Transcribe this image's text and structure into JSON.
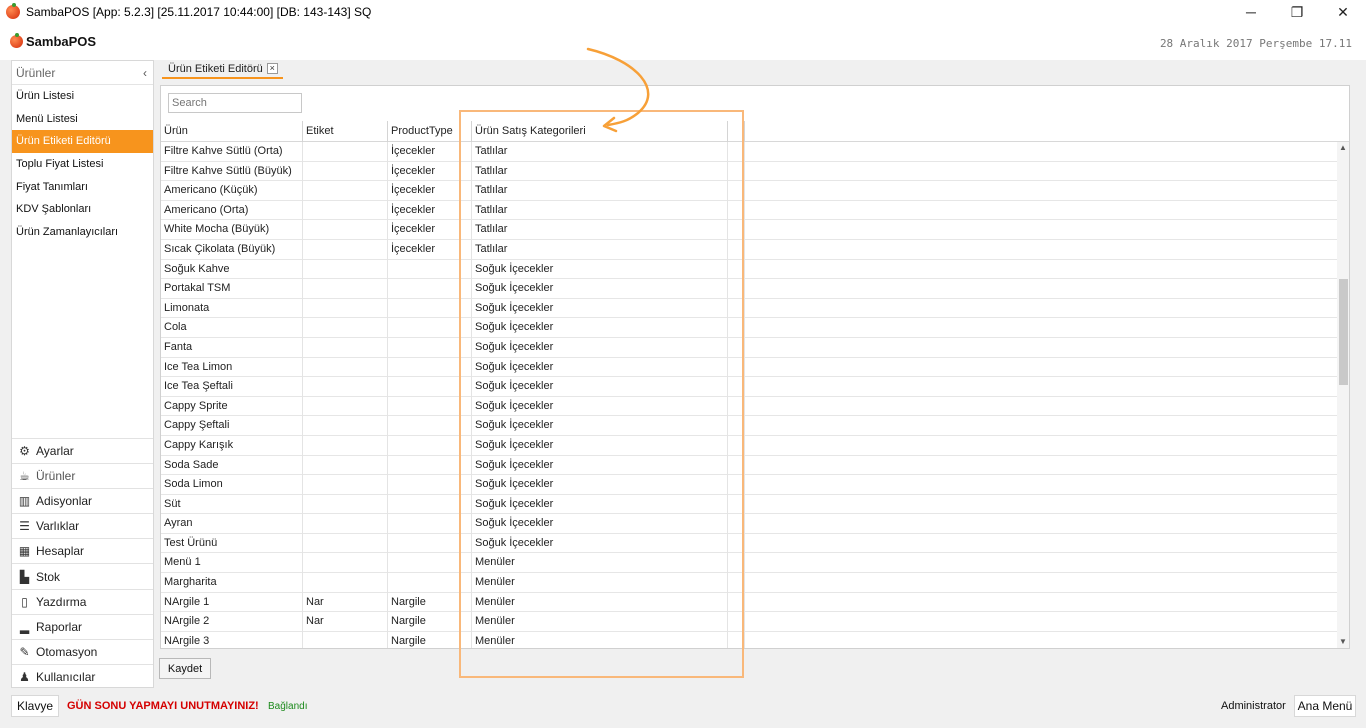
{
  "window": {
    "title": "SambaPOS [App: 5.2.3] [25.11.2017 10:44:00] [DB: 143-143] SQ",
    "minimize": "─",
    "restore": "❐",
    "close": "✕"
  },
  "header": {
    "logo": "SambaPOS",
    "date": "28 Aralık 2017 Perşembe 17.11"
  },
  "sidebar": {
    "section_title": "Ürünler",
    "collapse": "‹",
    "items": [
      {
        "label": "Ürün Listesi"
      },
      {
        "label": "Menü Listesi"
      },
      {
        "label": "Ürün Etiketi Editörü"
      },
      {
        "label": "Toplu Fiyat Listesi"
      },
      {
        "label": "Fiyat Tanımları"
      },
      {
        "label": "KDV Şablonları"
      },
      {
        "label": "Ürün Zamanlayıcıları"
      }
    ],
    "active_index": 2,
    "nav": [
      {
        "label": "Ayarlar",
        "icon": "gear-icon"
      },
      {
        "label": "Ürünler",
        "icon": "coffee-icon"
      },
      {
        "label": "Adisyonlar",
        "icon": "books-icon"
      },
      {
        "label": "Varlıklar",
        "icon": "list-icon"
      },
      {
        "label": "Hesaplar",
        "icon": "calculator-icon"
      },
      {
        "label": "Stok",
        "icon": "stock-icon"
      },
      {
        "label": "Yazdırma",
        "icon": "document-icon"
      },
      {
        "label": "Raporlar",
        "icon": "bar-chart-icon"
      },
      {
        "label": "Otomasyon",
        "icon": "pen-icon"
      },
      {
        "label": "Kullanıcılar",
        "icon": "user-icon"
      }
    ]
  },
  "tab": {
    "label": "Ürün Etiketi Editörü",
    "close": "×"
  },
  "editor": {
    "search_placeholder": "Search",
    "columns": [
      "Ürün",
      "Etiket",
      "ProductType",
      "Ürün  Satış Kategorileri"
    ],
    "rows": [
      [
        "Filtre Kahve Sütlü (Orta)",
        "",
        "İçecekler",
        "Tatlılar"
      ],
      [
        "Filtre Kahve Sütlü (Büyük)",
        "",
        "İçecekler",
        "Tatlılar"
      ],
      [
        "Americano (Küçük)",
        "",
        "İçecekler",
        "Tatlılar"
      ],
      [
        "Americano (Orta)",
        "",
        "İçecekler",
        "Tatlılar"
      ],
      [
        "White Mocha (Büyük)",
        "",
        "İçecekler",
        "Tatlılar"
      ],
      [
        "Sıcak Çikolata (Büyük)",
        "",
        "İçecekler",
        "Tatlılar"
      ],
      [
        "Soğuk Kahve",
        "",
        "",
        "Soğuk İçecekler"
      ],
      [
        "Portakal TSM",
        "",
        "",
        "Soğuk İçecekler"
      ],
      [
        "Limonata",
        "",
        "",
        "Soğuk İçecekler"
      ],
      [
        "Cola",
        "",
        "",
        "Soğuk İçecekler"
      ],
      [
        "Fanta",
        "",
        "",
        "Soğuk İçecekler"
      ],
      [
        "Ice Tea Limon",
        "",
        "",
        "Soğuk İçecekler"
      ],
      [
        "Ice Tea Şeftali",
        "",
        "",
        "Soğuk İçecekler"
      ],
      [
        "Cappy Sprite",
        "",
        "",
        "Soğuk İçecekler"
      ],
      [
        "Cappy Şeftali",
        "",
        "",
        "Soğuk İçecekler"
      ],
      [
        "Cappy Karışık",
        "",
        "",
        "Soğuk İçecekler"
      ],
      [
        "Soda Sade",
        "",
        "",
        "Soğuk İçecekler"
      ],
      [
        "Soda Limon",
        "",
        "",
        "Soğuk İçecekler"
      ],
      [
        "Süt",
        "",
        "",
        "Soğuk İçecekler"
      ],
      [
        "Ayran",
        "",
        "",
        "Soğuk İçecekler"
      ],
      [
        "Test Ürünü",
        "",
        "",
        "Soğuk İçecekler"
      ],
      [
        "Menü 1",
        "",
        "",
        "Menüler"
      ],
      [
        "Margharita",
        "",
        "",
        "Menüler"
      ],
      [
        "NArgile 1",
        "Nar",
        "Nargile",
        "Menüler"
      ],
      [
        "NArgile 2",
        "Nar",
        "Nargile",
        "Menüler"
      ],
      [
        "NArgile 3",
        "",
        "Nargile",
        "Menüler"
      ]
    ],
    "save_label": "Kaydet"
  },
  "statusbar": {
    "keyboard_label": "Klavye",
    "warning": "GÜN SONU YAPMAYI UNUTMAYINIZ!",
    "connection": "Bağlandı",
    "user": "Administrator",
    "main_menu_label": "Ana Menü"
  },
  "colors": {
    "accent": "#f7941d",
    "annotation": "#f9b87a",
    "warning": "#d40000",
    "connected": "#1c8a1c"
  }
}
